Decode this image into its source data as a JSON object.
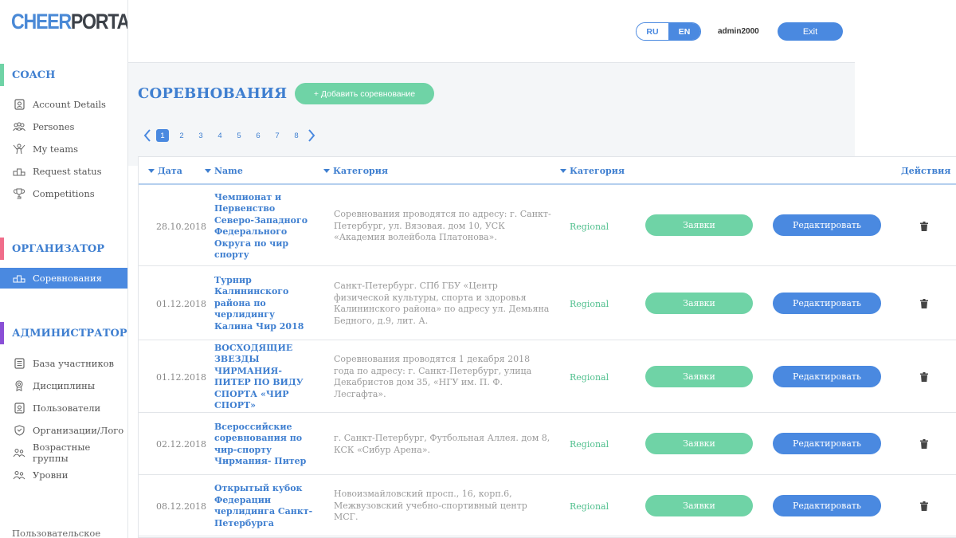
{
  "logo": {
    "part1": "CHEER",
    "part2": "PORTAL"
  },
  "sidebar": {
    "coach": {
      "title": "COACH",
      "color": "#6fd3a6",
      "items": [
        {
          "label": "Account Details",
          "icon": "badge-icon"
        },
        {
          "label": "Persones",
          "icon": "people-icon"
        },
        {
          "label": "My teams",
          "icon": "team-icon"
        },
        {
          "label": "Request status",
          "icon": "podium-icon"
        },
        {
          "label": "Competitions",
          "icon": "trophy-icon"
        }
      ]
    },
    "organizer": {
      "title": "ОРГАНИЗАТОР",
      "color": "#f06d8a",
      "items": [
        {
          "label": "Соревнования",
          "icon": "podium-icon",
          "active": true
        }
      ]
    },
    "admin": {
      "title": "АДМИНИСТРАТОР",
      "color": "#8a4fd6",
      "items": [
        {
          "label": "База участников",
          "icon": "list-icon"
        },
        {
          "label": "Дисциплины",
          "icon": "medal-icon"
        },
        {
          "label": "Пользователи",
          "icon": "badge-icon"
        },
        {
          "label": "Организации/Лого",
          "icon": "shield-icon"
        },
        {
          "label": "Возрастные группы",
          "icon": "people-icon"
        },
        {
          "label": "Уровни",
          "icon": "people-icon"
        }
      ]
    },
    "footer": "Пользовательское"
  },
  "header": {
    "lang_ru": "RU",
    "lang_en": "EN",
    "user": "admin2000",
    "exit": "Exit"
  },
  "main": {
    "title": "СОРЕВНОВАНИЯ",
    "add_button": "+ Добавить соревнование",
    "pages": [
      "1",
      "2",
      "3",
      "4",
      "5",
      "6",
      "7",
      "8"
    ],
    "active_page": "1"
  },
  "table": {
    "headers": {
      "date": "Дата",
      "name": "Name",
      "category1": "Категория",
      "category2": "Категория",
      "actions": "Действия"
    },
    "requests_label": "Заявки",
    "edit_label": "Редактировать",
    "rows": [
      {
        "date": "28.10.2018",
        "name": "Чемпионат и Первенство Северо-Западного Федерального Округа по чир спорту",
        "address": "Соревнования проводятся по адресу: г. Санкт-Петербург, ул. Вязовая. дом 10, УСК «Академия волейбола Платонова».",
        "category": "Regional"
      },
      {
        "date": "01.12.2018",
        "name": "Турнир Калининского района по черлидингу Калина Чир 2018",
        "address": "Санкт-Петербург. СПб ГБУ «Центр физической культуры, спорта и здоровья Калининского района» по адресу ул. Демьяна Бедного, д.9, лит. А.",
        "category": "Regional"
      },
      {
        "date": "01.12.2018",
        "name": "ВОСХОДЯЩИЕ ЗВЕЗДЫ ЧИРМАНИЯ-ПИТЕР ПО ВИДУ СПОРТА «ЧИР СПОРТ»",
        "address": "Соревнования проводятся 1 декабря 2018 года по адресу: г. Санкт-Петербург, улица Декабристов дом 35, «НГУ им. П. Ф. Лесгафта».",
        "category": "Regional"
      },
      {
        "date": "02.12.2018",
        "name": "Всероссийские соревнования по чир-спорту Чирмания- Питер",
        "address": "г. Санкт-Петербург, Футбольная Аллея. дом 8, КСК «Сибур Арена».",
        "category": "Regional"
      },
      {
        "date": "08.12.2018",
        "name": "Открытый кубок Федерации черлидинга Санкт-Петербурга",
        "address": "Новоизмайловский просп., 16, корп.6, Межвузовский учебно-спортивный центр МСГ.",
        "category": "Regional"
      }
    ]
  }
}
